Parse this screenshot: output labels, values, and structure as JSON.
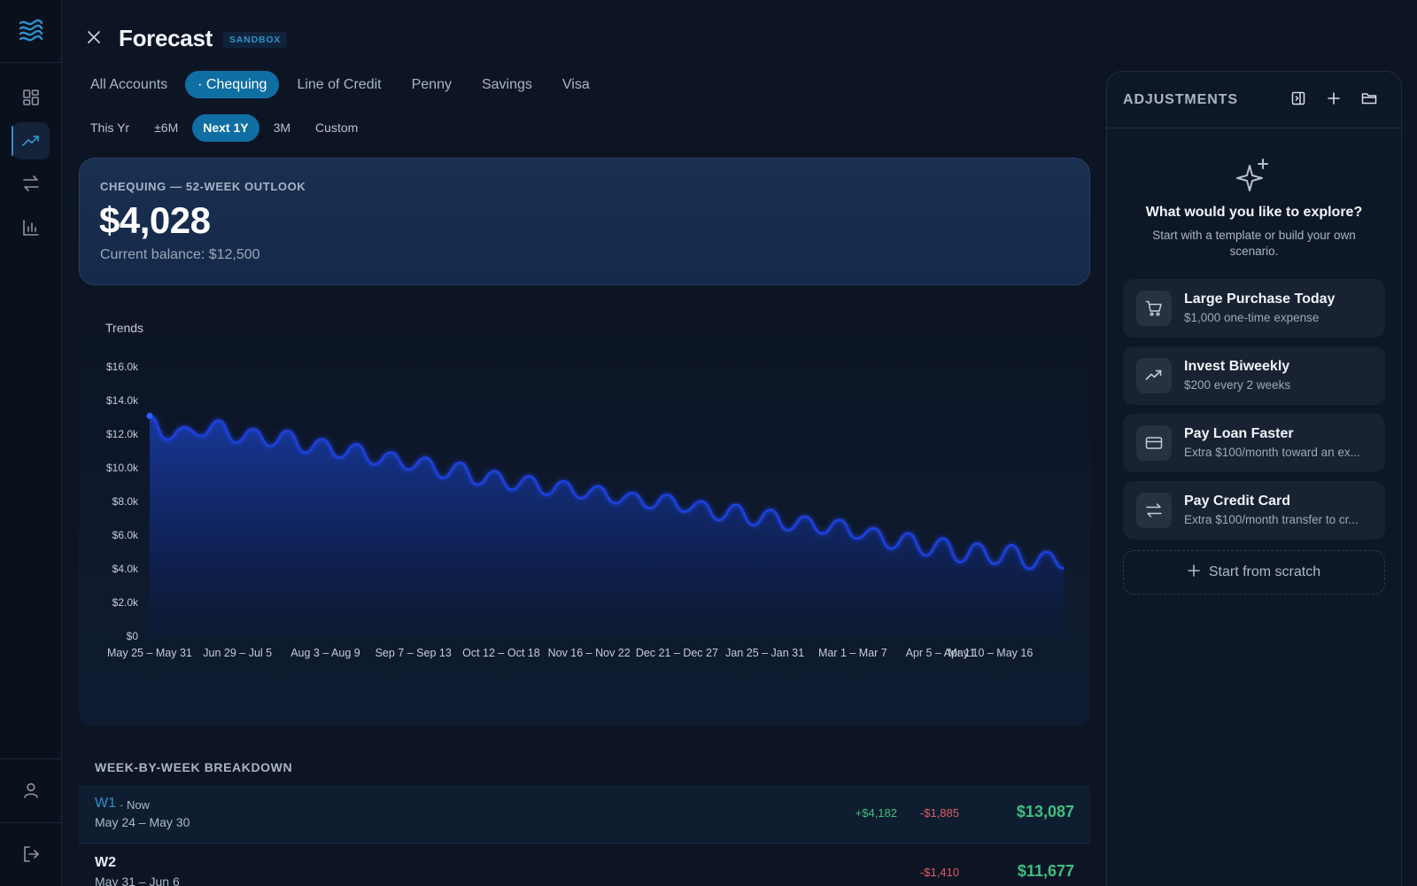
{
  "app": {
    "title": "Forecast",
    "badge": "SANDBOX",
    "accent": "#0f6fa3"
  },
  "sidebar": {
    "icons": [
      "waves-logo-icon",
      "dashboard-icon",
      "trend-up-icon",
      "transfer-icon",
      "bar-chart-icon",
      "user-icon",
      "logout-icon"
    ],
    "active": "trend-up-icon"
  },
  "account_tabs": [
    {
      "label": "All Accounts",
      "active": false
    },
    {
      "label": "· Chequing",
      "active": true
    },
    {
      "label": "Line of Credit",
      "active": false
    },
    {
      "label": "Penny",
      "active": false
    },
    {
      "label": "Savings",
      "active": false
    },
    {
      "label": "Visa",
      "active": false
    }
  ],
  "range_tabs": [
    {
      "label": "This Yr",
      "active": false
    },
    {
      "label": "±6M",
      "active": false
    },
    {
      "label": "Next 1Y",
      "active": true
    },
    {
      "label": "3M",
      "active": false
    },
    {
      "label": "Custom",
      "active": false
    }
  ],
  "outlook": {
    "label": "CHEQUING — 52-WEEK OUTLOOK",
    "value": "$4,028",
    "current_balance": "Current balance: $12,500"
  },
  "chart_data": {
    "type": "area",
    "title": "Trends",
    "ylim": [
      0,
      16000
    ],
    "y_ticks": [
      "$0",
      "$2.0k",
      "$4.0k",
      "$6.0k",
      "$8.0k",
      "$10.0k",
      "$12.0k",
      "$14.0k",
      "$16.0k"
    ],
    "x_tick_labels": [
      "May 25 – May 31",
      "Jun 29 – Jul 5",
      "Aug 3 – Aug 9",
      "Sep 7 – Sep 13",
      "Oct 12 – Oct 18",
      "Nov 16 – Nov 22",
      "Dec 21 – Dec 27",
      "Jan 25 – Jan 31",
      "Mar 1 – Mar 7",
      "Apr 5 – Apr 11",
      "May 10 – May 16"
    ],
    "x_tick_week_index": [
      0,
      5,
      10,
      15,
      20,
      25,
      30,
      35,
      40,
      45,
      50
    ],
    "series": [
      {
        "color": "#1d3fd6",
        "values": [
          13087,
          11677,
          12400,
          11900,
          12800,
          11500,
          12300,
          11300,
          12200,
          10900,
          11700,
          10600,
          11400,
          10200,
          10900,
          9900,
          10600,
          9400,
          10300,
          9000,
          9800,
          8700,
          9500,
          8400,
          9200,
          8200,
          8900,
          7900,
          8500,
          7600,
          8400,
          7400,
          8000,
          6900,
          7800,
          6600,
          7500,
          6300,
          7100,
          6100,
          6900,
          5800,
          6400,
          5200,
          6100,
          4800,
          5800,
          4400,
          5500,
          4300,
          5400,
          4000,
          5000,
          4028
        ]
      }
    ],
    "grid": false,
    "legend": "none"
  },
  "breakdown": {
    "label": "WEEK-BY-WEEK BREAKDOWN",
    "rows": [
      {
        "week": "W1",
        "tag": "· Now",
        "dates": "May 24 – May 30",
        "inflow": "+$4,182",
        "outflow": "-$1,885",
        "balance": "$13,087"
      },
      {
        "week": "W2",
        "tag": "",
        "dates": "May 31 – Jun 6",
        "inflow": "",
        "outflow": "-$1,410",
        "balance": "$11,677"
      }
    ]
  },
  "adjustments": {
    "title": "ADJUSTMENTS",
    "explore_title": "What would you like to explore?",
    "explore_sub": "Start with a template or build your own scenario.",
    "templates": [
      {
        "icon": "cart-icon",
        "title": "Large Purchase Today",
        "subtitle": "$1,000 one-time expense"
      },
      {
        "icon": "trend-up-icon",
        "title": "Invest Biweekly",
        "subtitle": "$200 every 2 weeks"
      },
      {
        "icon": "card-icon",
        "title": "Pay Loan Faster",
        "subtitle": "Extra $100/month toward an ex..."
      },
      {
        "icon": "transfer-icon",
        "title": "Pay Credit Card",
        "subtitle": "Extra $100/month transfer to cr..."
      }
    ],
    "scratch_label": "Start from scratch"
  }
}
